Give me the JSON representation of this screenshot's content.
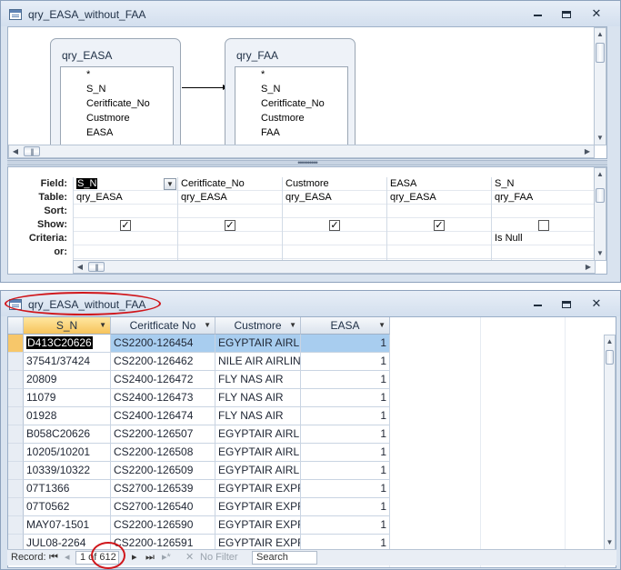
{
  "design_window": {
    "title": "qry_EASA_without_FAA",
    "tables": [
      {
        "name": "qry_EASA",
        "fields": [
          "*",
          "S_N",
          "Ceritficate_No",
          "Custmore",
          "EASA"
        ]
      },
      {
        "name": "qry_FAA",
        "fields": [
          "*",
          "S_N",
          "Ceritficate_No",
          "Custmore",
          "FAA"
        ]
      }
    ],
    "row_labels": [
      "Field:",
      "Table:",
      "Sort:",
      "Show:",
      "Criteria:",
      "or:"
    ],
    "columns": [
      {
        "field": "S_N",
        "table": "qry_EASA",
        "show": true,
        "criteria": ""
      },
      {
        "field": "Ceritficate_No",
        "table": "qry_EASA",
        "show": true,
        "criteria": ""
      },
      {
        "field": "Custmore",
        "table": "qry_EASA",
        "show": true,
        "criteria": ""
      },
      {
        "field": "EASA",
        "table": "qry_EASA",
        "show": true,
        "criteria": ""
      },
      {
        "field": "S_N",
        "table": "qry_FAA",
        "show": false,
        "criteria": "Is Null"
      }
    ]
  },
  "datasheet_window": {
    "title": "qry_EASA_without_FAA",
    "headers": [
      "S_N",
      "Ceritficate No",
      "Custmore",
      "EASA"
    ],
    "rows": [
      [
        "D413C20626",
        "CS2200-126454",
        "EGYPTAIR AIRLI",
        "1"
      ],
      [
        "37541/37424",
        "CS2200-126462",
        "NILE AIR AIRLIN",
        "1"
      ],
      [
        "20809",
        "CS2400-126472",
        "FLY NAS AIR",
        "1"
      ],
      [
        "11079",
        "CS2400-126473",
        "FLY NAS AIR",
        "1"
      ],
      [
        "01928",
        "CS2400-126474",
        "FLY NAS AIR",
        "1"
      ],
      [
        "B058C20626",
        "CS2200-126507",
        "EGYPTAIR AIRLI",
        "1"
      ],
      [
        "10205/10201",
        "CS2200-126508",
        "EGYPTAIR AIRLI",
        "1"
      ],
      [
        "10339/10322",
        "CS2200-126509",
        "EGYPTAIR AIRLI",
        "1"
      ],
      [
        "07T1366",
        "CS2700-126539",
        "EGYPTAIR EXPR",
        "1"
      ],
      [
        "07T0562",
        "CS2700-126540",
        "EGYPTAIR EXPR",
        "1"
      ],
      [
        "MAY07-1501",
        "CS2200-126590",
        "EGYPTAIR EXPR",
        "1"
      ],
      [
        "JUL08-2264",
        "CS2200-126591",
        "EGYPTAIR EXPR",
        "1"
      ]
    ],
    "record_nav": {
      "label": "Record:",
      "first": "⏮",
      "prev": "◂",
      "position": "1 of 612",
      "next": "▸",
      "last": "⏭",
      "new": "▸*",
      "filter_icon": "✕",
      "filter": "No Filter",
      "search": "Search"
    }
  },
  "colors": {
    "annotation": "#d0161b",
    "selected_row": "#a8cdef",
    "header_active": "#f6c35b"
  }
}
